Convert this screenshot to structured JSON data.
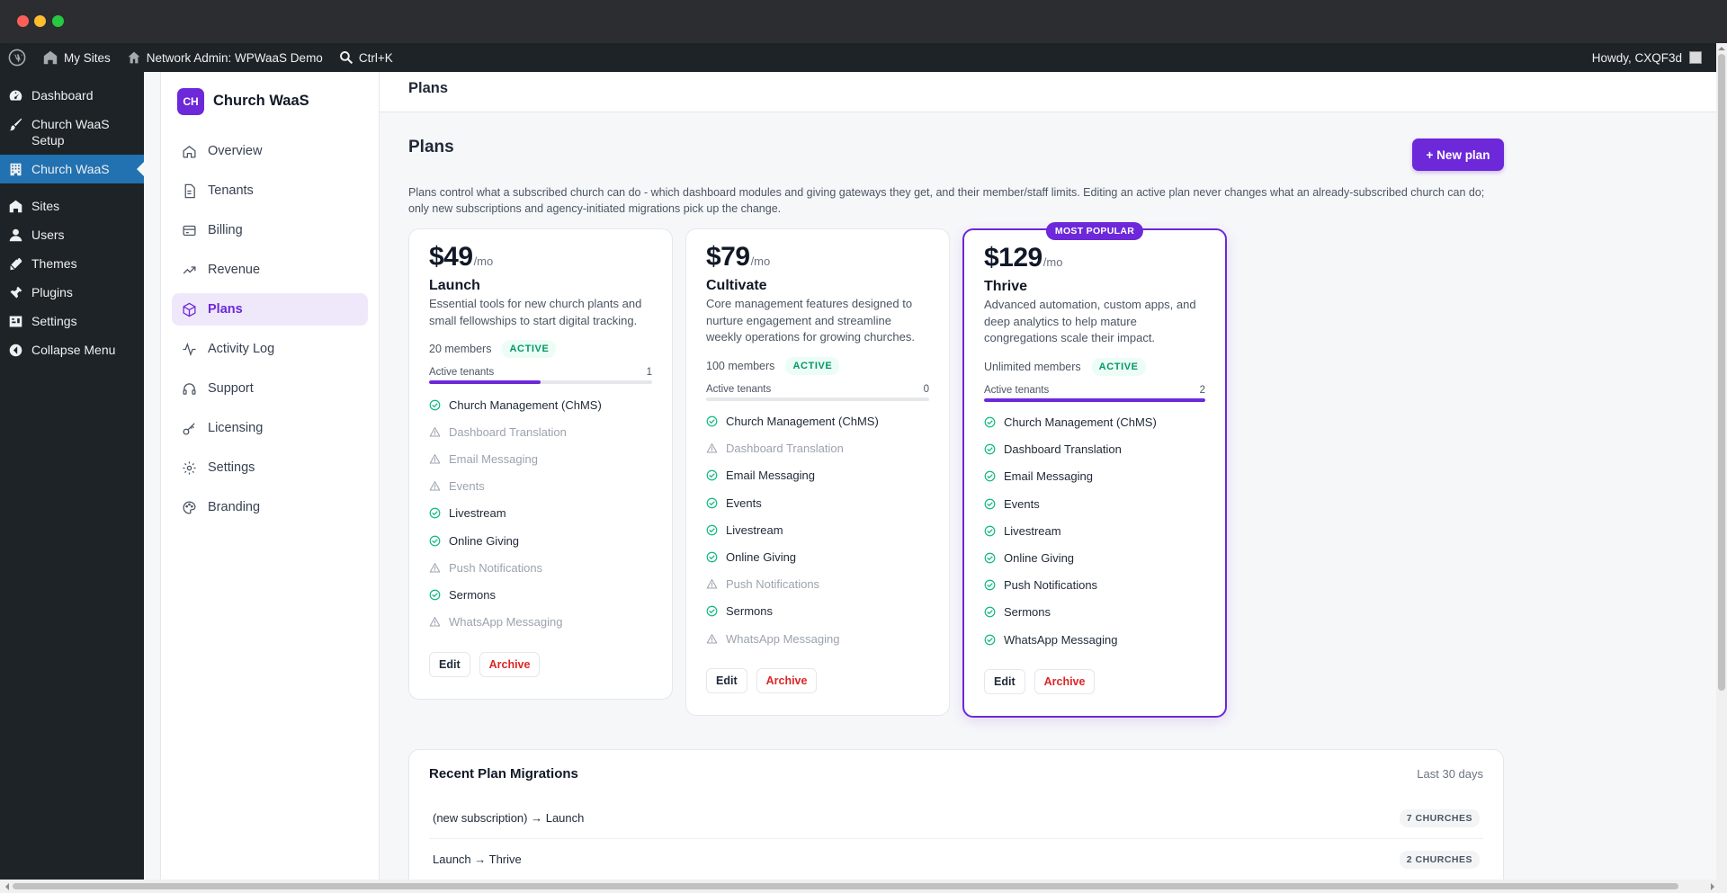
{
  "adminbar": {
    "my_sites": "My Sites",
    "network_admin": "Network Admin: WPWaaS Demo",
    "shortcut": "Ctrl+K",
    "howdy": "Howdy, CXQF3d"
  },
  "wpmenu": {
    "items": [
      {
        "label": "Dashboard",
        "icon": "dashboard-icon"
      },
      {
        "label": "Church WaaS Setup",
        "icon": "brush-icon"
      },
      {
        "label": "Church WaaS",
        "icon": "building-icon"
      },
      {
        "label": "Sites",
        "icon": "sites-icon"
      },
      {
        "label": "Users",
        "icon": "users-icon"
      },
      {
        "label": "Themes",
        "icon": "themes-icon"
      },
      {
        "label": "Plugins",
        "icon": "plugins-icon"
      },
      {
        "label": "Settings",
        "icon": "settings-icon"
      },
      {
        "label": "Collapse Menu",
        "icon": "collapse-icon"
      }
    ]
  },
  "plugin": {
    "badge": "CH",
    "name": "Church WaaS",
    "nav": [
      {
        "label": "Overview",
        "icon": "home-icon"
      },
      {
        "label": "Tenants",
        "icon": "file-icon"
      },
      {
        "label": "Billing",
        "icon": "card-icon"
      },
      {
        "label": "Revenue",
        "icon": "trend-icon"
      },
      {
        "label": "Plans",
        "icon": "cube-icon"
      },
      {
        "label": "Activity Log",
        "icon": "pulse-icon"
      },
      {
        "label": "Support",
        "icon": "headset-icon"
      },
      {
        "label": "Licensing",
        "icon": "key-icon"
      },
      {
        "label": "Settings",
        "icon": "gear-icon"
      },
      {
        "label": "Branding",
        "icon": "palette-icon"
      }
    ],
    "active_nav": "Plans"
  },
  "page": {
    "topbar_title": "Plans",
    "heading": "Plans",
    "new_plan": "+ New plan",
    "description": "Plans control what a subscribed church can do - which dashboard modules and giving gateways they get, and their member/staff limits. Editing an active plan never changes what an already-subscribed church can do; only new subscriptions and agency-initiated migrations pick up the change."
  },
  "plans": [
    {
      "price": "$49",
      "per": "/mo",
      "name": "Launch",
      "tagline": "Essential tools for new church plants and small fellowships to start digital tracking.",
      "members": "20 members",
      "status": "ACTIVE",
      "tenants_label": "Active tenants",
      "tenants": "1",
      "tenant_fill": 0.5,
      "popular": false,
      "features": [
        {
          "label": "Church Management (ChMS)",
          "on": true
        },
        {
          "label": "Dashboard Translation",
          "on": false
        },
        {
          "label": "Email Messaging",
          "on": false
        },
        {
          "label": "Events",
          "on": false
        },
        {
          "label": "Livestream",
          "on": true
        },
        {
          "label": "Online Giving",
          "on": true
        },
        {
          "label": "Push Notifications",
          "on": false
        },
        {
          "label": "Sermons",
          "on": true
        },
        {
          "label": "WhatsApp Messaging",
          "on": false
        }
      ],
      "edit": "Edit",
      "archive": "Archive"
    },
    {
      "price": "$79",
      "per": "/mo",
      "name": "Cultivate",
      "tagline": "Core management features designed to nurture engagement and streamline weekly operations for growing churches.",
      "members": "100 members",
      "status": "ACTIVE",
      "tenants_label": "Active tenants",
      "tenants": "0",
      "tenant_fill": 0,
      "popular": false,
      "features": [
        {
          "label": "Church Management (ChMS)",
          "on": true
        },
        {
          "label": "Dashboard Translation",
          "on": false
        },
        {
          "label": "Email Messaging",
          "on": true
        },
        {
          "label": "Events",
          "on": true
        },
        {
          "label": "Livestream",
          "on": true
        },
        {
          "label": "Online Giving",
          "on": true
        },
        {
          "label": "Push Notifications",
          "on": false
        },
        {
          "label": "Sermons",
          "on": true
        },
        {
          "label": "WhatsApp Messaging",
          "on": false
        }
      ],
      "edit": "Edit",
      "archive": "Archive"
    },
    {
      "price": "$129",
      "per": "/mo",
      "name": "Thrive",
      "tagline": "Advanced automation, custom apps, and deep analytics to help mature congregations scale their impact.",
      "members": "Unlimited members",
      "status": "ACTIVE",
      "tenants_label": "Active tenants",
      "tenants": "2",
      "tenant_fill": 1,
      "popular": true,
      "popular_label": "MOST POPULAR",
      "features": [
        {
          "label": "Church Management (ChMS)",
          "on": true
        },
        {
          "label": "Dashboard Translation",
          "on": true
        },
        {
          "label": "Email Messaging",
          "on": true
        },
        {
          "label": "Events",
          "on": true
        },
        {
          "label": "Livestream",
          "on": true
        },
        {
          "label": "Online Giving",
          "on": true
        },
        {
          "label": "Push Notifications",
          "on": true
        },
        {
          "label": "Sermons",
          "on": true
        },
        {
          "label": "WhatsApp Messaging",
          "on": true
        }
      ],
      "edit": "Edit",
      "archive": "Archive"
    }
  ],
  "migrations": {
    "title": "Recent Plan Migrations",
    "range": "Last 30 days",
    "rows": [
      {
        "label": "(new subscription) → Launch",
        "count": "7 CHURCHES"
      },
      {
        "label": "Launch → Thrive",
        "count": "2 CHURCHES"
      }
    ]
  },
  "colors": {
    "accent": "#6d28d9",
    "wp_blue": "#2271b1",
    "active_green": "#059669",
    "archive_red": "#dc2626"
  }
}
